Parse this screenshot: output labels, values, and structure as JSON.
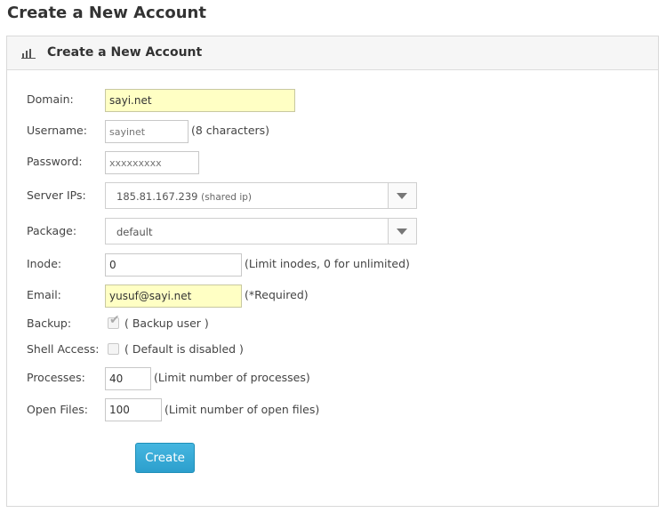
{
  "page": {
    "title": "Create a New Account"
  },
  "panel": {
    "title": "Create a New Account",
    "icon": "bar-chart-icon"
  },
  "form": {
    "domain": {
      "label": "Domain:",
      "value": "sayi.net"
    },
    "username": {
      "label": "Username:",
      "placeholder": "sayinet",
      "note": "(8 characters)"
    },
    "password": {
      "label": "Password:",
      "placeholder": "xxxxxxxxx"
    },
    "server_ips": {
      "label": "Server IPs:",
      "value": "185.81.167.239",
      "suffix": "(shared ip)"
    },
    "package": {
      "label": "Package:",
      "value": "default"
    },
    "inode": {
      "label": "Inode:",
      "value": "0",
      "note": "(Limit inodes, 0 for unlimited)"
    },
    "email": {
      "label": "Email:",
      "value": "yusuf@sayi.net",
      "note": "(*Required)"
    },
    "backup": {
      "label": "Backup:",
      "checked": true,
      "note": "( Backup user )"
    },
    "shell_access": {
      "label": "Shell Access:",
      "checked": false,
      "note": "( Default is disabled )"
    },
    "processes": {
      "label": "Processes:",
      "value": "40",
      "note": "(Limit number of processes)"
    },
    "open_files": {
      "label": "Open Files:",
      "value": "100",
      "note": "(Limit number of open files)"
    }
  },
  "buttons": {
    "create": "Create"
  },
  "colors": {
    "highlight_field": "#ffffc4",
    "button": "#2ea3d1"
  }
}
